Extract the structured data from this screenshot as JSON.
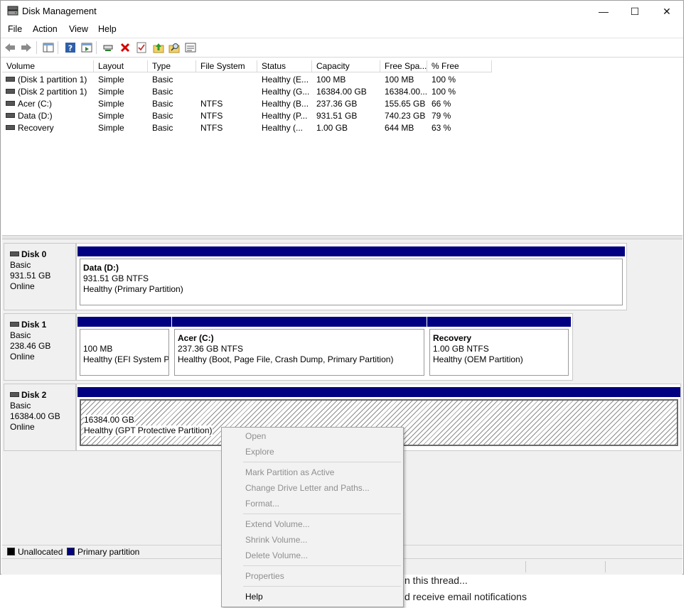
{
  "window": {
    "title": "Disk Management",
    "controls": {
      "minimize": "—",
      "maximize": "☐",
      "close": "✕"
    }
  },
  "menu": [
    "File",
    "Action",
    "View",
    "Help"
  ],
  "toolbar": {
    "buttons": [
      "back-arrow-icon",
      "forward-arrow-icon",
      "console-tree-icon",
      "help-icon",
      "properties-icon",
      "connect-icon",
      "delete-icon",
      "checklist-icon",
      "folder-up-icon",
      "search-folder-icon",
      "details-icon"
    ]
  },
  "volume_list": {
    "columns": [
      "Volume",
      "Layout",
      "Type",
      "File System",
      "Status",
      "Capacity",
      "Free Spa...",
      "% Free"
    ],
    "rows": [
      [
        "(Disk 1 partition 1)",
        "Simple",
        "Basic",
        "",
        "Healthy (E...",
        "100 MB",
        "100 MB",
        "100 %"
      ],
      [
        "(Disk 2 partition 1)",
        "Simple",
        "Basic",
        "",
        "Healthy (G...",
        "16384.00 GB",
        "16384.00...",
        "100 %"
      ],
      [
        "Acer (C:)",
        "Simple",
        "Basic",
        "NTFS",
        "Healthy (B...",
        "237.36 GB",
        "155.65 GB",
        "66 %"
      ],
      [
        "Data (D:)",
        "Simple",
        "Basic",
        "NTFS",
        "Healthy (P...",
        "931.51 GB",
        "740.23 GB",
        "79 %"
      ],
      [
        "Recovery",
        "Simple",
        "Basic",
        "NTFS",
        "Healthy (...",
        "1.00 GB",
        "644 MB",
        "63 %"
      ]
    ]
  },
  "disks": [
    {
      "name": "Disk 0",
      "type": "Basic",
      "size": "931.51 GB",
      "state": "Online",
      "partitions": [
        {
          "name": "Data  (D:)",
          "size": "931.51 GB NTFS",
          "status": "Healthy (Primary Partition)"
        }
      ]
    },
    {
      "name": "Disk 1",
      "type": "Basic",
      "size": "238.46 GB",
      "state": "Online",
      "partitions": [
        {
          "name": "",
          "size": "100 MB",
          "status": "Healthy (EFI System Pa"
        },
        {
          "name": "Acer  (C:)",
          "size": "237.36 GB NTFS",
          "status": "Healthy (Boot, Page File, Crash Dump, Primary Partition)"
        },
        {
          "name": "Recovery",
          "size": "1.00 GB NTFS",
          "status": "Healthy (OEM Partition)"
        }
      ]
    },
    {
      "name": "Disk 2",
      "type": "Basic",
      "size": "16384.00 GB",
      "state": "Online",
      "partitions": [
        {
          "name": "",
          "size": "16384.00 GB",
          "status": "Healthy (GPT Protective Partition)"
        }
      ]
    }
  ],
  "legend": [
    {
      "label": "Unallocated",
      "color": "#000000"
    },
    {
      "label": "Primary partition",
      "color": "#000080"
    }
  ],
  "context_menu": {
    "items": [
      {
        "label": "Open",
        "enabled": false
      },
      {
        "label": "Explore",
        "enabled": false
      },
      {
        "label": "Mark Partition as Active",
        "enabled": false
      },
      {
        "label": "Change Drive Letter and Paths...",
        "enabled": false
      },
      {
        "label": "Format...",
        "enabled": false
      },
      {
        "label": "Extend Volume...",
        "enabled": false
      },
      {
        "label": "Shrink Volume...",
        "enabled": false
      },
      {
        "label": "Delete Volume...",
        "enabled": false
      },
      {
        "label": "Properties",
        "enabled": false
      },
      {
        "label": "Help",
        "enabled": true
      }
    ]
  },
  "background_page": {
    "text1": "n this thread...",
    "text2": "d receive email notifications"
  }
}
